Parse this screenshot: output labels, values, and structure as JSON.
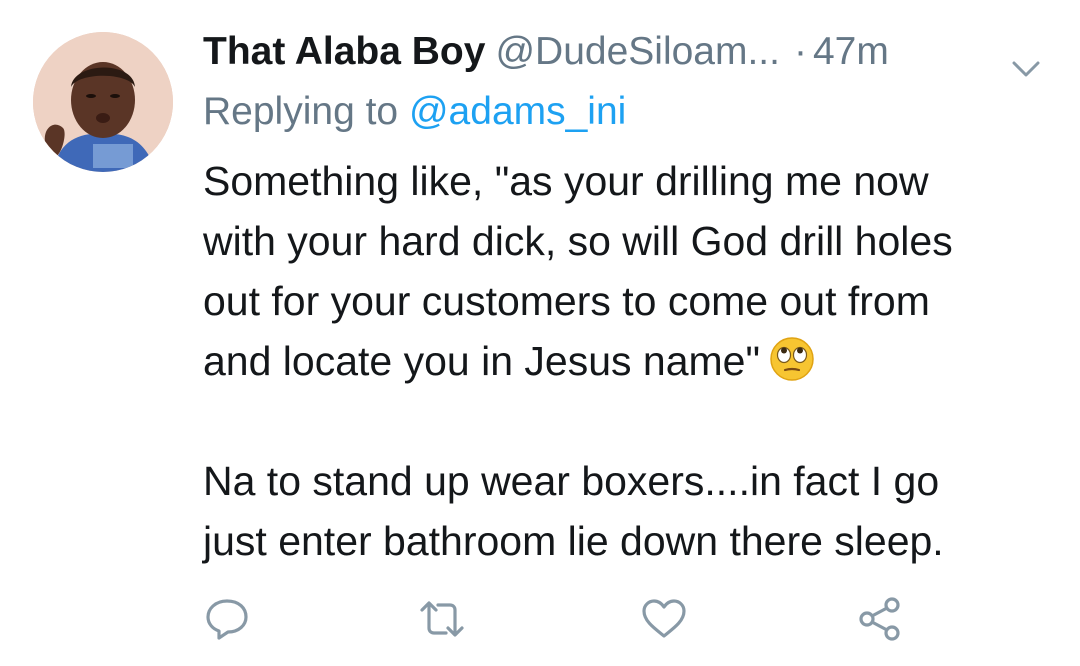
{
  "tweet": {
    "display_name": "That Alaba Boy",
    "handle": "@DudeSiloam...",
    "separator": "·",
    "time": "47m",
    "reply_prefix": "Replying to",
    "reply_handle": "@adams_ini",
    "lines": [
      "Something like, \"as your drilling me now",
      "with your hard dick, so will God drill holes",
      "out for your customers to come out from",
      "and locate you in Jesus name\"",
      "Na to stand up wear boxers....in fact I go",
      "just enter bathroom lie down there sleep."
    ],
    "emoji": "face-with-rolling-eyes"
  },
  "icons": {
    "reply": "speech-bubble-icon",
    "retweet": "retweet-icon",
    "like": "heart-icon",
    "share": "share-icon",
    "more": "chevron-down-icon"
  },
  "colors": {
    "text": "#14171a",
    "secondary": "#657786",
    "link": "#1da1f2",
    "icon": "#8899a6"
  }
}
